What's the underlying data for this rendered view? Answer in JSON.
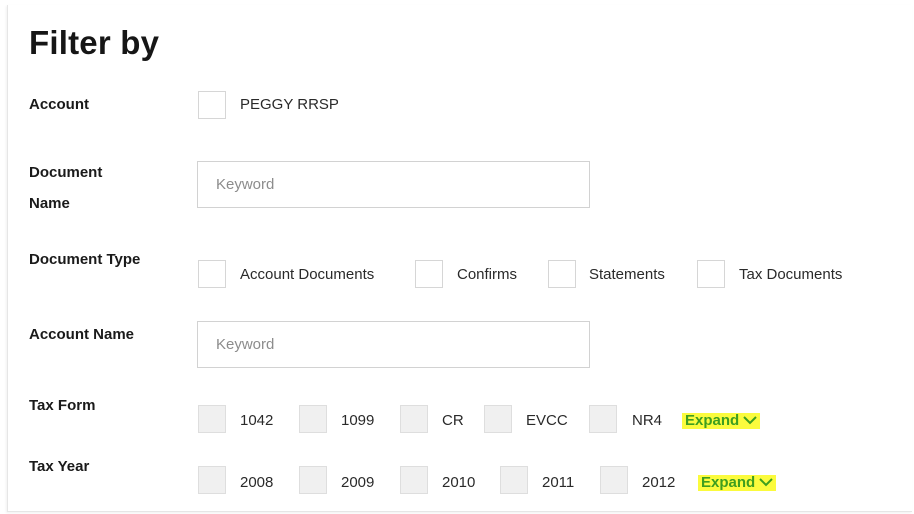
{
  "title": "Filter by",
  "account": {
    "label": "Account",
    "option": "PEGGY RRSP"
  },
  "document_name": {
    "label_line1": "Document",
    "label_line2": "Name",
    "placeholder": "Keyword"
  },
  "document_type": {
    "label": "Document Type",
    "options": [
      "Account Documents",
      "Confirms",
      "Statements",
      "Tax Documents"
    ]
  },
  "account_name": {
    "label": "Account Name",
    "placeholder": "Keyword"
  },
  "tax_form": {
    "label": "Tax Form",
    "options": [
      "1042",
      "1099",
      "CR",
      "EVCC",
      "NR4"
    ],
    "expand_label": "Expand"
  },
  "tax_year": {
    "label": "Tax Year",
    "options": [
      "2008",
      "2009",
      "2010",
      "2011",
      "2012"
    ],
    "expand_label": "Expand"
  },
  "colors": {
    "expand_text": "#3e9e1f",
    "expand_highlight": "#fbfb3d"
  },
  "icons": {
    "expand_chevron": "chevron-down-icon"
  }
}
